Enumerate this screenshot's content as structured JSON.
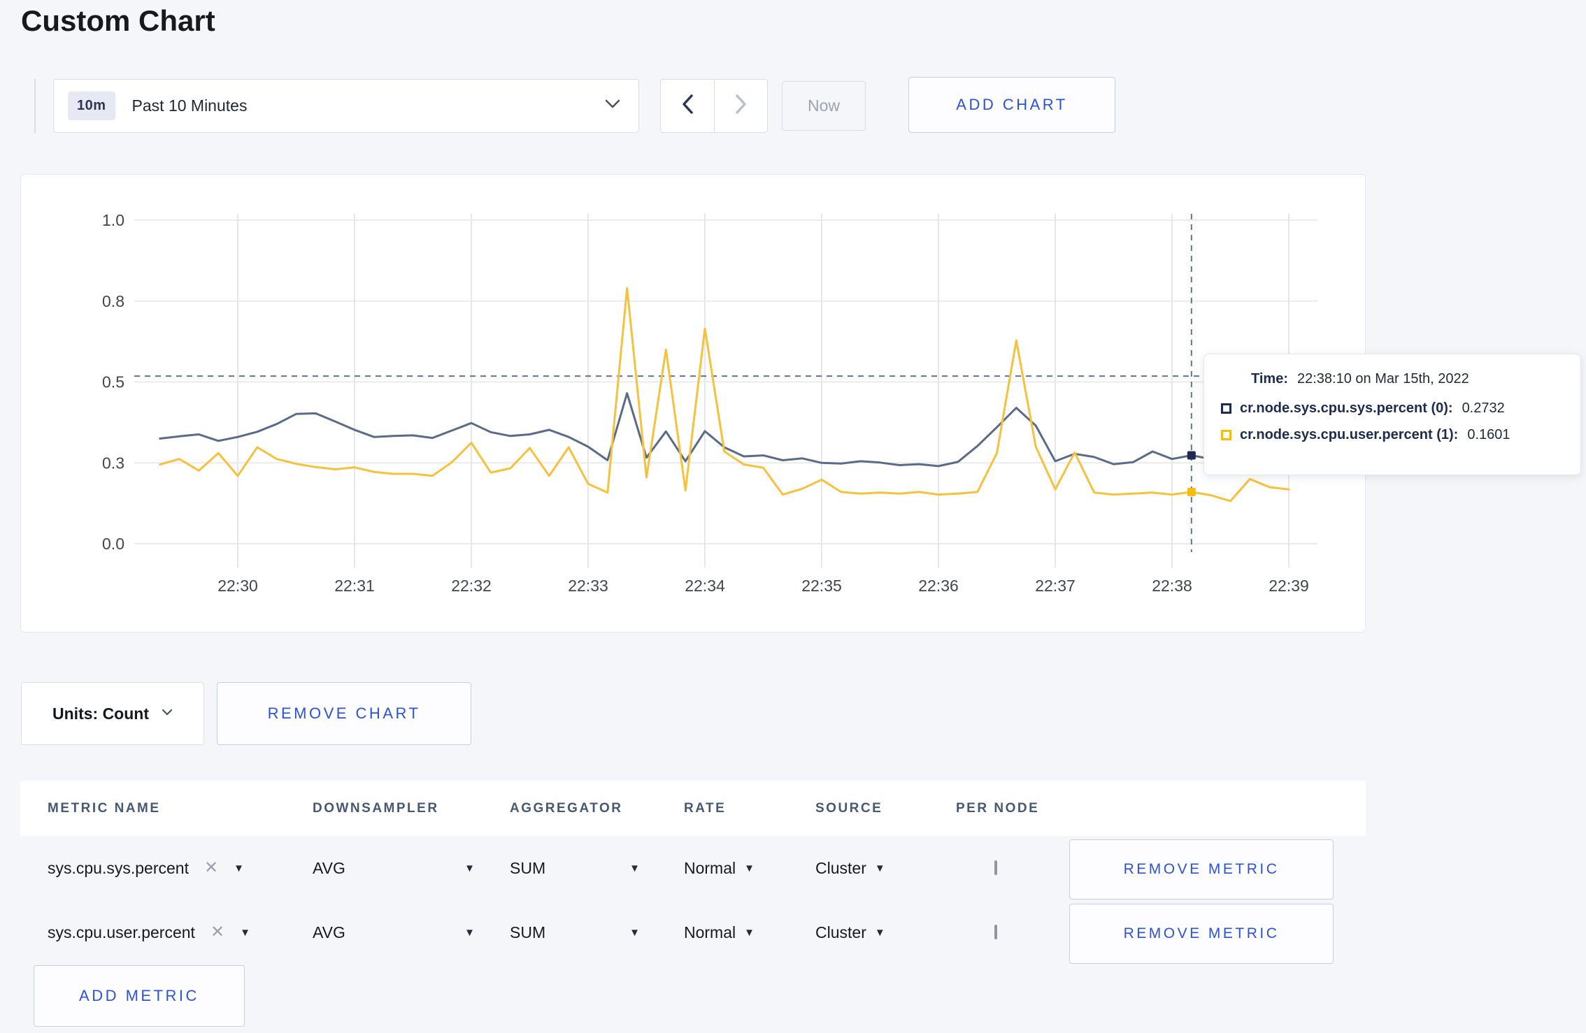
{
  "page": {
    "title": "Custom Chart"
  },
  "toolbar": {
    "range_badge": "10m",
    "range_label": "Past 10 Minutes",
    "now_label": "Now",
    "add_chart_label": "ADD CHART"
  },
  "chart": {
    "units_label": "Units: Count",
    "remove_chart_label": "REMOVE CHART",
    "tooltip": {
      "time_label": "Time:",
      "time_value": "22:38:10 on Mar 15th, 2022",
      "series": [
        {
          "label": "cr.node.sys.cpu.sys.percent (0):",
          "value": "0.2732",
          "color": "#1d2c4e"
        },
        {
          "label": "cr.node.sys.cpu.user.percent (1):",
          "value": "0.1601",
          "color": "#f5bd10"
        }
      ]
    }
  },
  "chart_data": {
    "type": "line",
    "title": "",
    "ylabel": "",
    "xlabel": "",
    "ylim": [
      0,
      1
    ],
    "grid": true,
    "x_ticks": [
      "22:30",
      "22:31",
      "22:32",
      "22:33",
      "22:34",
      "22:35",
      "22:36",
      "22:37",
      "22:38",
      "22:39"
    ],
    "y_gridlines": [
      0,
      0.25,
      0.5,
      0.75,
      1.0
    ],
    "y_tick_labels": [
      "0.0",
      "0.3",
      "0.5",
      "0.8",
      "1.0"
    ],
    "x_start_offset_seconds": -40,
    "x_interval_seconds": 10,
    "crosshair": {
      "time": "22:38:10",
      "offset_seconds": 490,
      "guide_value": 0.518
    },
    "highlight_index": 53,
    "series": [
      {
        "name": "cr.node.sys.cpu.sys.percent",
        "color": "#5a6b87",
        "swatch": "#1d2c4e",
        "values": [
          0.325,
          0.332,
          0.338,
          0.318,
          0.33,
          0.346,
          0.37,
          0.401,
          0.403,
          0.378,
          0.352,
          0.33,
          0.333,
          0.335,
          0.327,
          0.35,
          0.373,
          0.345,
          0.333,
          0.338,
          0.352,
          0.33,
          0.3,
          0.258,
          0.465,
          0.266,
          0.347,
          0.255,
          0.348,
          0.298,
          0.27,
          0.273,
          0.258,
          0.264,
          0.25,
          0.248,
          0.255,
          0.251,
          0.243,
          0.246,
          0.24,
          0.253,
          0.302,
          0.36,
          0.42,
          0.365,
          0.255,
          0.278,
          0.268,
          0.246,
          0.252,
          0.285,
          0.262,
          0.2732,
          0.262,
          0.255,
          0.25,
          0.255,
          0.26
        ]
      },
      {
        "name": "cr.node.sys.cpu.user.percent",
        "color": "#f6c13d",
        "swatch": "#f5bd10",
        "values": [
          0.245,
          0.262,
          0.226,
          0.28,
          0.21,
          0.298,
          0.262,
          0.247,
          0.237,
          0.23,
          0.236,
          0.222,
          0.216,
          0.216,
          0.21,
          0.252,
          0.312,
          0.22,
          0.233,
          0.296,
          0.21,
          0.298,
          0.185,
          0.158,
          0.79,
          0.205,
          0.6,
          0.165,
          0.665,
          0.285,
          0.245,
          0.235,
          0.152,
          0.17,
          0.198,
          0.16,
          0.155,
          0.158,
          0.155,
          0.16,
          0.152,
          0.155,
          0.16,
          0.28,
          0.628,
          0.3,
          0.168,
          0.282,
          0.158,
          0.152,
          0.155,
          0.158,
          0.152,
          0.1601,
          0.15,
          0.132,
          0.2,
          0.175,
          0.168
        ]
      }
    ]
  },
  "metrics_table": {
    "headers": [
      "METRIC NAME",
      "DOWNSAMPLER",
      "AGGREGATOR",
      "RATE",
      "SOURCE",
      "PER NODE"
    ],
    "rows": [
      {
        "metric": "sys.cpu.sys.percent",
        "downsampler": "AVG",
        "aggregator": "SUM",
        "rate": "Normal",
        "source": "Cluster",
        "remove_label": "REMOVE METRIC"
      },
      {
        "metric": "sys.cpu.user.percent",
        "downsampler": "AVG",
        "aggregator": "SUM",
        "rate": "Normal",
        "source": "Cluster",
        "remove_label": "REMOVE METRIC"
      }
    ],
    "add_metric_label": "ADD METRIC"
  }
}
